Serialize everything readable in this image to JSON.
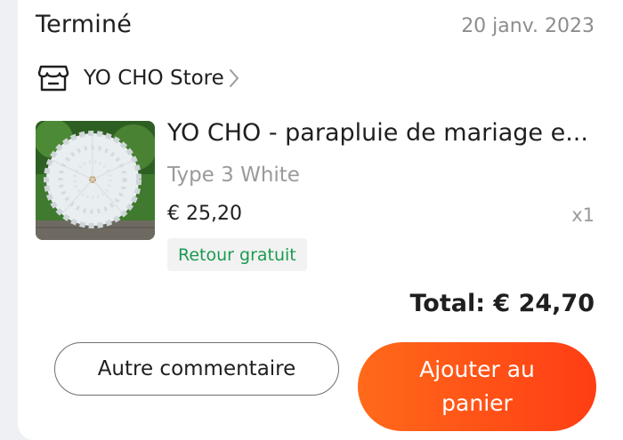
{
  "order": {
    "status": "Terminé",
    "date": "20 janv. 2023"
  },
  "store": {
    "name": "YO CHO Store",
    "icon": "store-icon",
    "chevron": "chevron-right-icon"
  },
  "item": {
    "title": "YO CHO - parapluie de mariage e...",
    "variant": "Type 3 White",
    "price": "€ 25,20",
    "quantity": "x1",
    "tag": "Retour gratuit"
  },
  "summary": {
    "total": "Total: € 24,70"
  },
  "actions": {
    "secondary_label": "Autre commentaire",
    "primary_label": "Ajouter au panier"
  },
  "colors": {
    "accent": "#ff4d17",
    "return_green": "#1a9a52",
    "muted": "#9a9a9a"
  }
}
